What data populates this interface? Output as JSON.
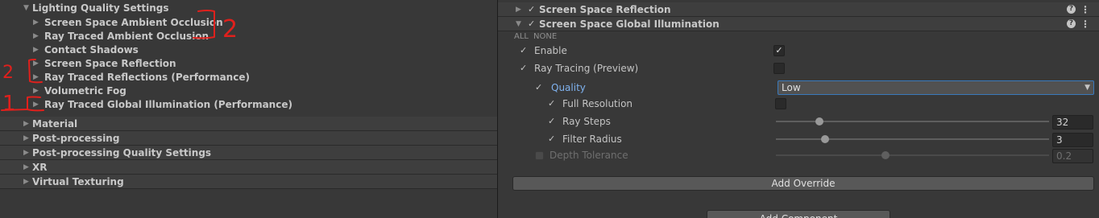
{
  "left_panel": {
    "items": [
      {
        "label": "Lighting Quality Settings",
        "expanded": true
      },
      {
        "label": "Screen Space Ambient Occlusion"
      },
      {
        "label": "Ray Traced Ambient Occlusion"
      },
      {
        "label": "Contact Shadows"
      },
      {
        "label": "Screen Space Reflection"
      },
      {
        "label": "Ray Traced Reflections (Performance)"
      },
      {
        "label": "Volumetric Fog"
      },
      {
        "label": "Ray Traced Global Illumination (Performance)"
      }
    ],
    "sections": [
      {
        "label": "Material"
      },
      {
        "label": "Post-processing"
      },
      {
        "label": "Post-processing Quality Settings"
      },
      {
        "label": "XR"
      },
      {
        "label": "Virtual Texturing"
      }
    ],
    "annotations": {
      "bracket_number_top": "2",
      "bracket_number_mid": "2",
      "bracket_number_low": "1",
      "color": "#e0201c"
    }
  },
  "right_panel": {
    "components": [
      {
        "title": "Screen Space Reflection",
        "enabled": true,
        "expanded": false
      },
      {
        "title": "Screen Space Global Illumination",
        "enabled": true,
        "expanded": true
      }
    ],
    "all_label": "ALL",
    "none_label": "NONE",
    "properties": {
      "enable": {
        "label": "Enable",
        "override": true,
        "value_checked": true
      },
      "ray_tracing": {
        "label": "Ray Tracing (Preview)",
        "override": true,
        "value_checked": false
      },
      "quality": {
        "label": "Quality",
        "override": true,
        "value": "Low"
      },
      "full_resolution": {
        "label": "Full Resolution",
        "override": true,
        "value_checked": false
      },
      "ray_steps": {
        "label": "Ray Steps",
        "override": true,
        "value": "32",
        "slider_fraction": 0.16
      },
      "filter_radius": {
        "label": "Filter Radius",
        "override": true,
        "value": "3",
        "slider_fraction": 0.18
      },
      "depth_tolerance": {
        "label": "Depth Tolerance",
        "override": false,
        "value": "0.2",
        "slider_fraction": 0.4
      }
    },
    "add_override_label": "Add Override",
    "add_component_label": "Add Component"
  },
  "colors": {
    "panel_bg": "#383838",
    "header_bg": "#3e3e3e",
    "accent_blue": "#7fb2ef",
    "annotation_red": "#e0201c"
  }
}
